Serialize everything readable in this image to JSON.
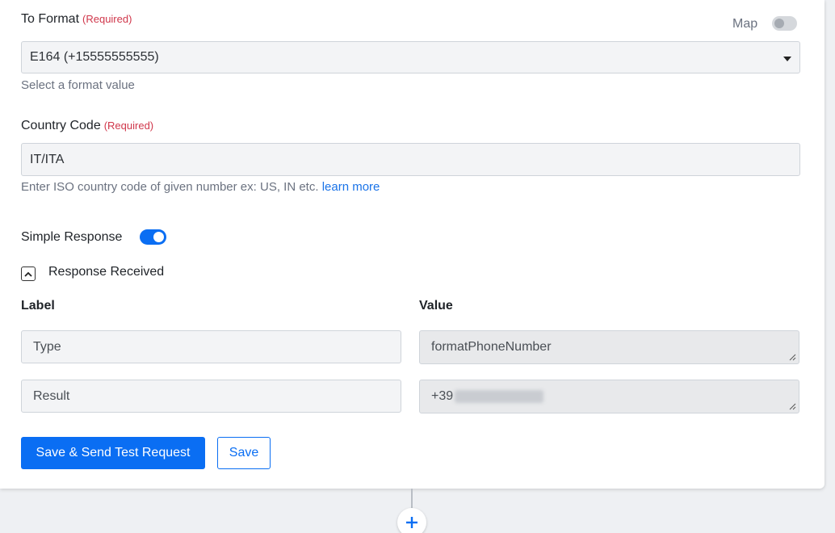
{
  "to_format": {
    "label": "To Format",
    "required": "(Required)",
    "map_label": "Map",
    "value": "E164 (+15555555555)",
    "help": "Select a format value"
  },
  "country_code": {
    "label": "Country Code",
    "required": "(Required)",
    "value": "IT/ITA",
    "help": "Enter ISO country code of given number ex: US, IN etc.",
    "learn_more": "learn more"
  },
  "simple_response": {
    "label": "Simple Response"
  },
  "response_received": {
    "label": "Response Received",
    "col_label": "Label",
    "col_value": "Value",
    "rows": [
      {
        "label": "Type",
        "value": "formatPhoneNumber"
      },
      {
        "label": "Result",
        "value": "+39"
      }
    ]
  },
  "actions": {
    "save_send": "Save & Send Test Request",
    "save": "Save"
  },
  "colors": {
    "primary": "#0a6ef3",
    "required": "#d0374b",
    "toggle_on": "#0a6ef3",
    "toggle_off": "#d5d8dc"
  }
}
